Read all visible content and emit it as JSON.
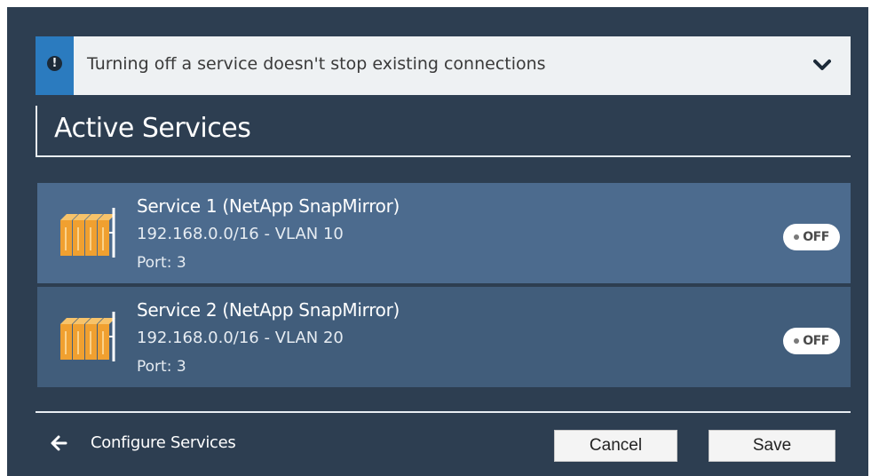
{
  "banner": {
    "icon": "info-icon",
    "text": "Turning off a service doesn't stop existing connections",
    "expand_icon": "chevron-down-icon",
    "accent_color": "#2b7bbf"
  },
  "section": {
    "title": "Active Services"
  },
  "services": [
    {
      "name": "Service 1 (NetApp SnapMirror)",
      "network": "192.168.0.0/16 - VLAN 10",
      "port": "Port: 3",
      "icon": "storage-array-icon",
      "toggle": "OFF"
    },
    {
      "name": "Service 2 (NetApp SnapMirror)",
      "network": "192.168.0.0/16 - VLAN 20",
      "port": "Port: 3",
      "icon": "storage-array-icon",
      "toggle": "OFF"
    }
  ],
  "footer": {
    "back_icon": "arrow-left-icon",
    "back_label": "Configure Services",
    "cancel_label": "Cancel",
    "save_label": "Save"
  },
  "colors": {
    "panel_bg": "#2d3e51",
    "row_primary": "#4c6b8e",
    "row_secondary": "#415d7b",
    "icon_orange": "#f0a030"
  }
}
